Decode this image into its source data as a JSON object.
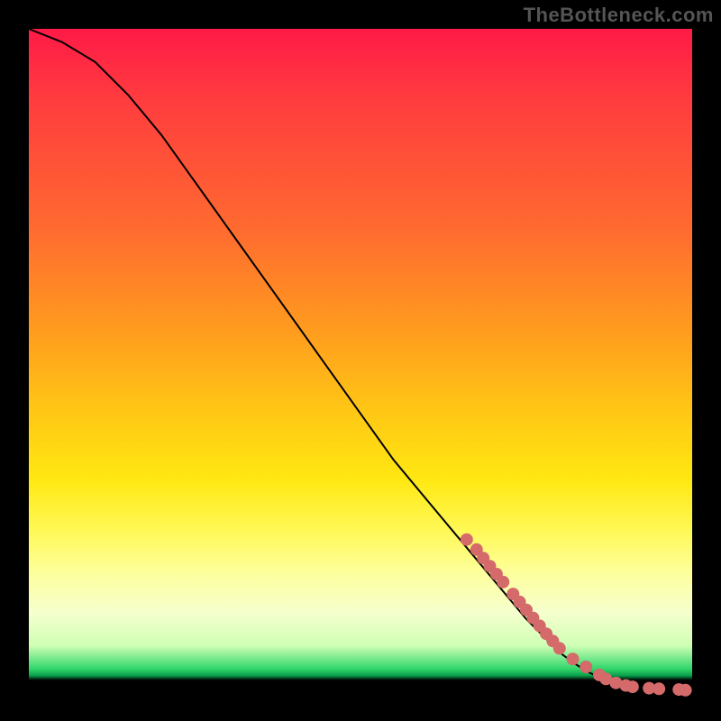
{
  "watermark": "TheBottleneck.com",
  "chart_data": {
    "type": "line",
    "title": "",
    "xlabel": "",
    "ylabel": "",
    "xlim": [
      0,
      100
    ],
    "ylim": [
      0,
      100
    ],
    "grid": false,
    "legend": false,
    "series": [
      {
        "name": "curve",
        "color": "#000000",
        "x": [
          0,
          5,
          10,
          15,
          20,
          25,
          30,
          35,
          40,
          45,
          50,
          55,
          60,
          65,
          70,
          75,
          80,
          82,
          84,
          86,
          88,
          90,
          92,
          94,
          96,
          98,
          100
        ],
        "y": [
          100,
          98,
          95,
          90,
          84,
          77,
          70,
          63,
          56,
          49,
          42,
          35,
          29,
          23,
          17,
          11,
          6,
          4.5,
          3.2,
          2.2,
          1.5,
          1.0,
          0.7,
          0.5,
          0.4,
          0.3,
          0.3
        ]
      },
      {
        "name": "points",
        "type": "scatter",
        "color": "#d46a6a",
        "x": [
          66,
          67.5,
          68.5,
          69.5,
          70.5,
          71.5,
          73,
          74,
          75,
          76,
          77,
          78,
          79,
          80,
          82,
          84,
          86,
          87,
          88.5,
          90,
          91,
          93.5,
          95,
          98,
          99
        ],
        "y": [
          23,
          21.5,
          20.2,
          19,
          17.8,
          16.6,
          14.8,
          13.6,
          12.4,
          11.2,
          10,
          8.8,
          7.7,
          6.6,
          5.0,
          3.8,
          2.6,
          2.0,
          1.4,
          1.0,
          0.8,
          0.6,
          0.5,
          0.4,
          0.3
        ]
      }
    ]
  },
  "colors": {
    "point_fill": "#d46a6a",
    "curve": "#000000"
  }
}
